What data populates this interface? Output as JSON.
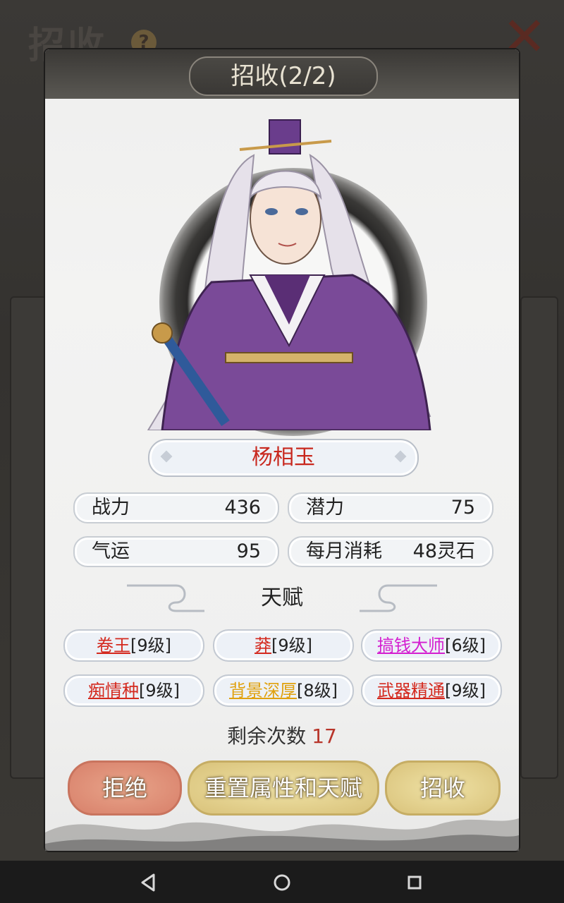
{
  "background": {
    "title": "招收",
    "help_icon": "question-mark-icon",
    "close_icon": "close-x-icon"
  },
  "dialog": {
    "title": "招收(2/2)",
    "character_name": "杨相玉",
    "stats": {
      "power_label": "战力",
      "power_value": "436",
      "potential_label": "潜力",
      "potential_value": "75",
      "luck_label": "气运",
      "luck_value": "95",
      "monthly_cost_label": "每月消耗",
      "monthly_cost_value": "48灵石"
    },
    "talents_title": "天赋",
    "talents": [
      {
        "name": "卷王",
        "level": "[9级]",
        "color": "#d4291e"
      },
      {
        "name": "莽",
        "level": "[9级]",
        "color": "#d4291e"
      },
      {
        "name": "搞钱大师",
        "level": "[6级]",
        "color": "#d41fd0"
      },
      {
        "name": "痴情种",
        "level": "[9级]",
        "color": "#d4291e"
      },
      {
        "name": "背景深厚",
        "level": "[8级]",
        "color": "#e0a10f"
      },
      {
        "name": "武器精通",
        "level": "[9级]",
        "color": "#d4291e"
      }
    ],
    "remaining_label": "剩余次数",
    "remaining_value": "17",
    "buttons": {
      "reject": "拒绝",
      "reset": "重置属性和天赋",
      "recruit": "招收"
    }
  },
  "navbar": {
    "back_icon": "back-triangle-icon",
    "home_icon": "home-circle-icon",
    "recents_icon": "recents-square-icon"
  }
}
